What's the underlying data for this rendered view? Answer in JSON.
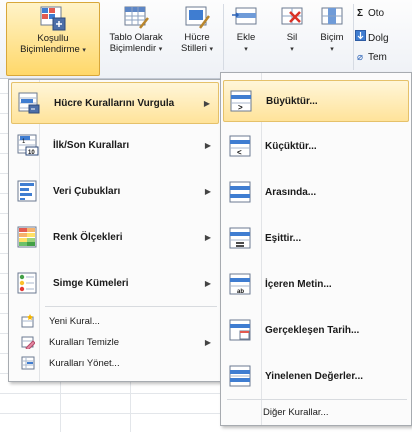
{
  "ribbon": {
    "cond_format": {
      "line1": "Koşullu",
      "line2": "Biçimlendirme"
    },
    "table_format": {
      "line1": "Tablo Olarak",
      "line2": "Biçimlendir"
    },
    "cell_styles": {
      "line1": "Hücre",
      "line2": "Stilleri"
    },
    "insert": "Ekle",
    "delete": "Sil",
    "format": "Biçim",
    "autosum": "Oto",
    "fill": "Dolg",
    "clear": "Tem"
  },
  "menu_main": {
    "items": [
      {
        "label": "Hücre Kurallarını Vurgula",
        "icon": "highlight-rules-icon"
      },
      {
        "label": "İlk/Son Kuralları",
        "icon": "top-bottom-rules-icon"
      },
      {
        "label": "Veri Çubukları",
        "icon": "data-bars-icon"
      },
      {
        "label": "Renk Ölçekleri",
        "icon": "color-scales-icon"
      },
      {
        "label": "Simge Kümeleri",
        "icon": "icon-sets-icon"
      }
    ],
    "small_items": [
      {
        "label": "Yeni Kural...",
        "icon": "new-rule-icon"
      },
      {
        "label": "Kuralları Temizle",
        "icon": "clear-rules-icon"
      },
      {
        "label": "Kuralları Yönet...",
        "icon": "manage-rules-icon"
      }
    ]
  },
  "menu_sub": {
    "items": [
      {
        "label": "Büyüktür...",
        "icon": "greater-than-icon"
      },
      {
        "label": "Küçüktür...",
        "icon": "less-than-icon"
      },
      {
        "label": "Arasında...",
        "icon": "between-icon"
      },
      {
        "label": "Eşittir...",
        "icon": "equal-to-icon"
      },
      {
        "label": "İçeren Metin...",
        "icon": "text-contains-icon"
      },
      {
        "label": "Gerçekleşen Tarih...",
        "icon": "date-occurring-icon"
      },
      {
        "label": "Yinelenen Değerler...",
        "icon": "duplicate-values-icon"
      }
    ],
    "more": "Diğer Kurallar..."
  },
  "colors": {
    "highlight": "#ffe39a",
    "accent": "#2d63b7"
  }
}
